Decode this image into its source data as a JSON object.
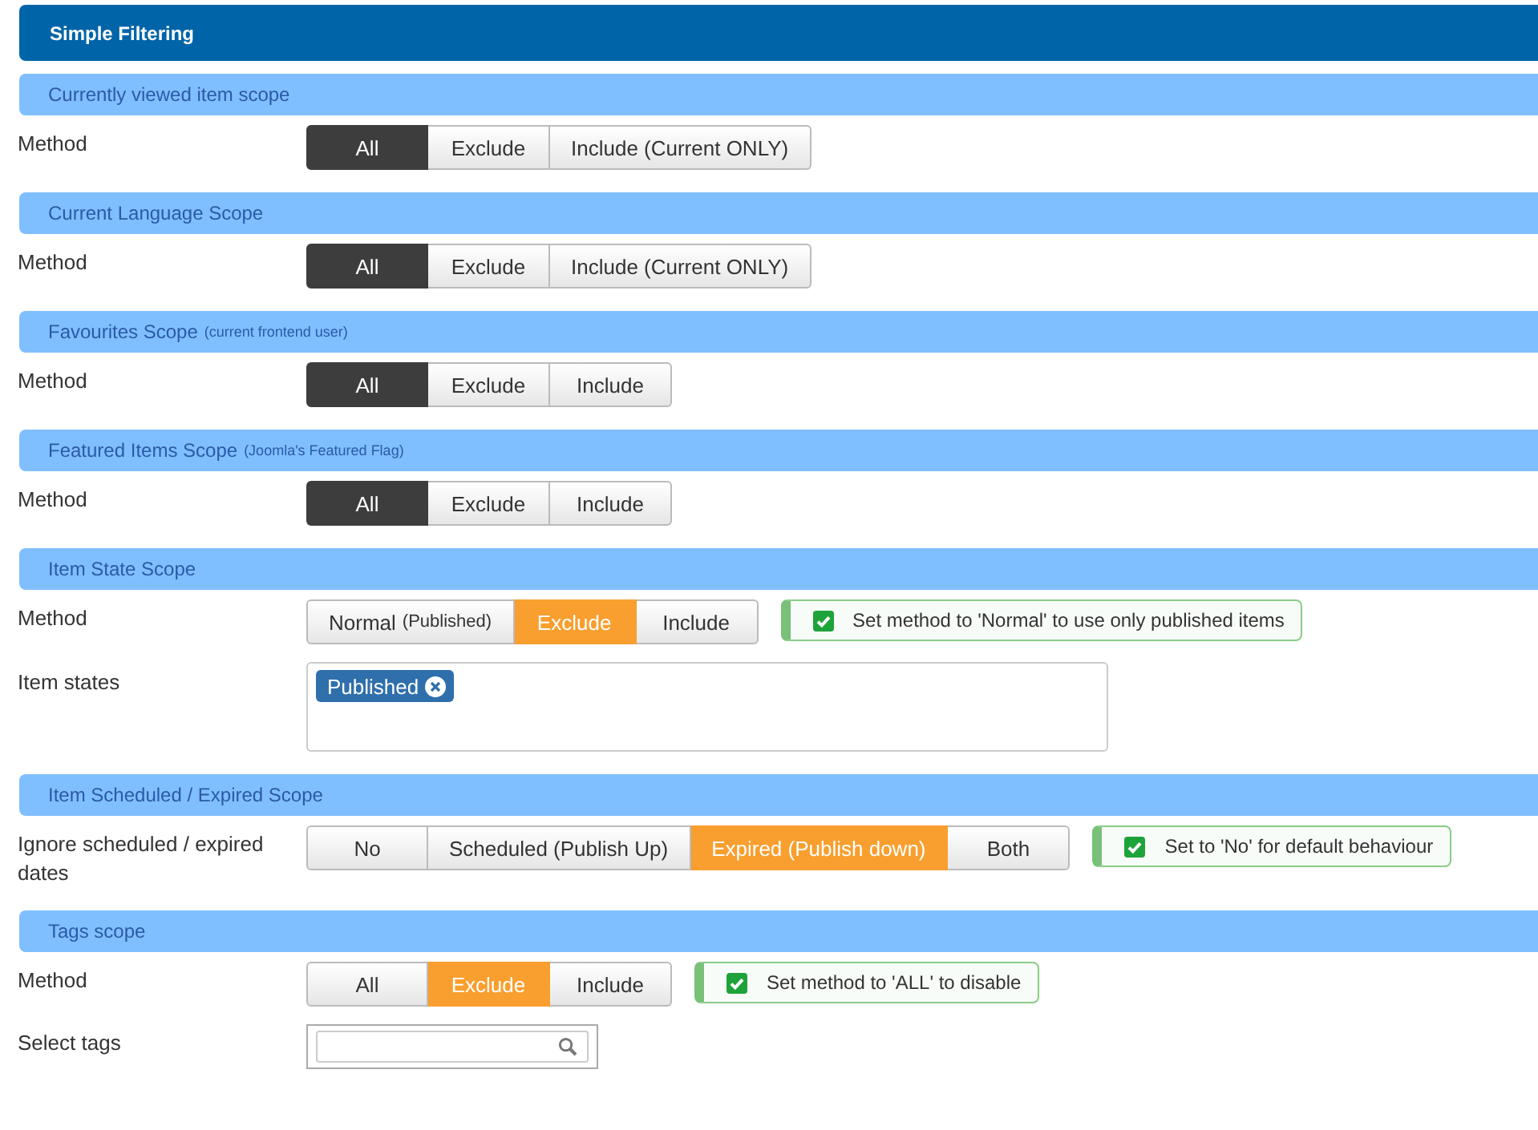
{
  "header": {
    "title": "Simple Filtering"
  },
  "sections": [
    {
      "title": "Currently viewed item scope",
      "rows": [
        {
          "kind": "buttons",
          "label": "Method",
          "color": "#3d3d3d",
          "options": [
            {
              "label": "All",
              "selected": true
            },
            {
              "label": "Exclude",
              "selected": false
            },
            {
              "label": "Include (Current ONLY)",
              "selected": false
            }
          ]
        }
      ]
    },
    {
      "title": "Current Language Scope",
      "rows": [
        {
          "kind": "buttons",
          "label": "Method",
          "color": "#3d3d3d",
          "options": [
            {
              "label": "All",
              "selected": true
            },
            {
              "label": "Exclude",
              "selected": false
            },
            {
              "label": "Include (Current ONLY)",
              "selected": false
            }
          ]
        }
      ]
    },
    {
      "title": "Favourites Scope",
      "note": "(current frontend user)",
      "rows": [
        {
          "kind": "buttons",
          "label": "Method",
          "color": "#3d3d3d",
          "options": [
            {
              "label": "All",
              "selected": true
            },
            {
              "label": "Exclude",
              "selected": false
            },
            {
              "label": "Include",
              "selected": false
            }
          ]
        }
      ]
    },
    {
      "title": "Featured Items Scope",
      "note": "(Joomla's Featured Flag)",
      "rows": [
        {
          "kind": "buttons",
          "label": "Method",
          "color": "#3d3d3d",
          "options": [
            {
              "label": "All",
              "selected": true
            },
            {
              "label": "Exclude",
              "selected": false
            },
            {
              "label": "Include",
              "selected": false
            }
          ]
        }
      ]
    },
    {
      "title": "Item State Scope",
      "rows": [
        {
          "kind": "buttons",
          "label": "Method",
          "color": "#f89f2f",
          "options": [
            {
              "label": "Normal",
              "note": "(Published)",
              "selected": false
            },
            {
              "label": "Exclude",
              "selected": true
            },
            {
              "label": "Include",
              "selected": false
            }
          ],
          "hint": {
            "text": "Set method to 'Normal' to use only published items",
            "checked": true
          }
        },
        {
          "kind": "tags",
          "label": "Item states",
          "tags": [
            "Published"
          ]
        }
      ]
    },
    {
      "title": "Item Scheduled / Expired Scope",
      "rows": [
        {
          "kind": "buttons",
          "label": "Ignore scheduled / expired dates",
          "color": "#f89f2f",
          "options": [
            {
              "label": "No",
              "selected": false
            },
            {
              "label": "Scheduled (Publish Up)",
              "selected": false
            },
            {
              "label": "Expired (Publish down)",
              "selected": true
            },
            {
              "label": "Both",
              "selected": false
            }
          ],
          "hint": {
            "text": "Set to 'No' for default behaviour",
            "checked": true
          }
        }
      ]
    },
    {
      "title": "Tags scope",
      "rows": [
        {
          "kind": "buttons",
          "label": "Method",
          "color": "#f89f2f",
          "options": [
            {
              "label": "All",
              "selected": false
            },
            {
              "label": "Exclude",
              "selected": true
            },
            {
              "label": "Include",
              "selected": false
            }
          ],
          "hint": {
            "text": "Set method to 'ALL' to disable",
            "checked": true
          }
        },
        {
          "kind": "search",
          "label": "Select tags"
        }
      ]
    }
  ]
}
